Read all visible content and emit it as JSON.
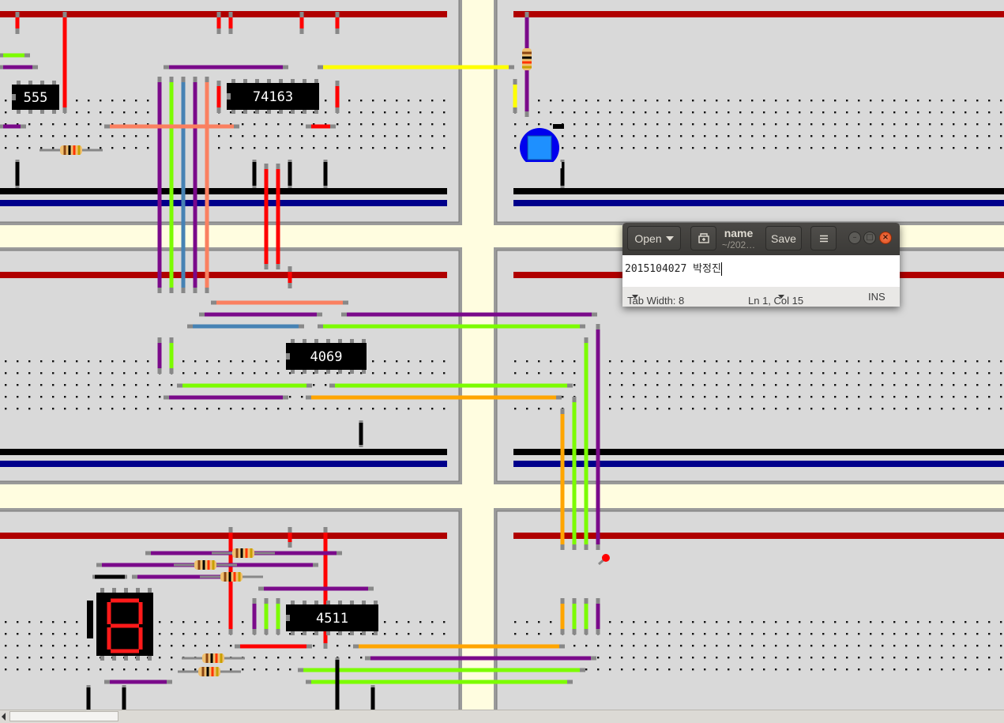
{
  "circuit": {
    "chips": [
      {
        "label": "555",
        "color": "#000000"
      },
      {
        "label": "74163",
        "color": "#000000"
      },
      {
        "label": "4069",
        "color": "#000000"
      },
      {
        "label": "4511",
        "color": "#000000"
      }
    ],
    "seven_segment_digit": "8",
    "seven_segment_color": "#ff1a1a",
    "colors": {
      "breadboard": "#d9d9d9",
      "background": "#fffde0",
      "power_rail_red": "#b00000",
      "ground_rail_black": "#000000",
      "ground_rail_blue": "#00008b",
      "wire_purple": "#7a0a8a",
      "wire_green": "#7cfc00",
      "wire_steelblue": "#4682b4",
      "wire_salmon": "#fa8060",
      "wire_red": "#ff0000",
      "wire_yellow": "#ffff00",
      "wire_orange": "#ffa500",
      "led_blue": "#1e90ff"
    }
  },
  "editor": {
    "open_label": "Open",
    "title": "name",
    "subtitle": "~/202…",
    "save_label": "Save",
    "menu_icon": "hamburger-menu-icon",
    "text": "2015104027 박정진",
    "tab_width": "Tab Width: 8",
    "cursor_pos": "Ln 1, Col 15",
    "mode": "INS"
  }
}
